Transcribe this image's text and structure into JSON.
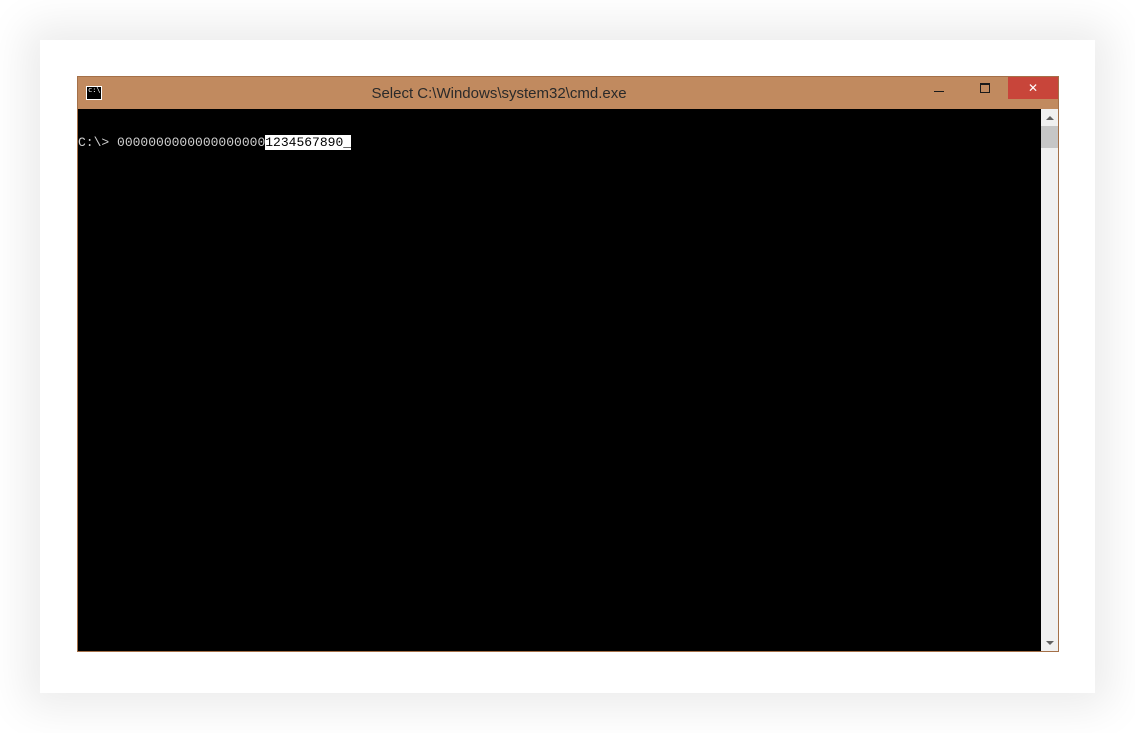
{
  "window": {
    "title": "Select C:\\Windows\\system32\\cmd.exe"
  },
  "terminal": {
    "prompt": "C:\\> ",
    "typed_unselected": "0000000000000000000",
    "typed_selected": "1234567890",
    "cursor": "_"
  },
  "colors": {
    "titlebar": "#c18a5f",
    "close": "#c8453a",
    "terminal_bg": "#000000",
    "terminal_fg": "#d0d0d0"
  }
}
